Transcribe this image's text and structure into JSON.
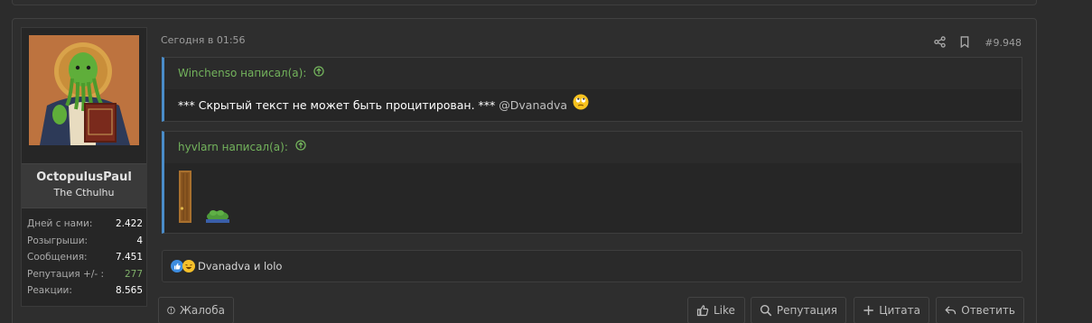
{
  "post": {
    "date": "Сегодня в 01:56",
    "number": "#9.948"
  },
  "user": {
    "name": "OctopulusPaul",
    "title": "The Cthulhu",
    "stats": [
      {
        "label": "Дней с нами:",
        "value": "2.422"
      },
      {
        "label": "Розыгрыши:",
        "value": "4"
      },
      {
        "label": "Сообщения:",
        "value": "7.451"
      },
      {
        "label": "Репутация +/- :",
        "value": "277"
      },
      {
        "label": "Реакции:",
        "value": "8.565"
      }
    ]
  },
  "quotes": [
    {
      "author": "Winchenso написал(а):",
      "text": "*** Скрытый текст не может быть процитирован. ***",
      "mention": "@Dvanadva"
    },
    {
      "author": "hyvlarn написал(а):"
    }
  ],
  "reactions": {
    "text": "Dvanadva и lolo"
  },
  "buttons": {
    "report": "Жалоба",
    "like": "Like",
    "reputation": "Репутация",
    "quote": "Цитата",
    "reply": "Ответить"
  },
  "colors": {
    "accent_green": "#73b35c",
    "quote_border": "#4a8cc9",
    "background": "#2c2c2c"
  }
}
